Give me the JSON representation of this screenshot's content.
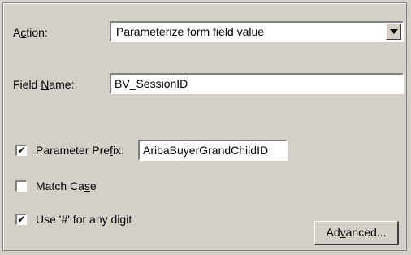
{
  "action": {
    "label_pre": "A",
    "label_u": "c",
    "label_post": "tion:",
    "selected": "Parameterize form field value",
    "dropdown_icon": "chevron-down-icon"
  },
  "field_name": {
    "label_pre": "Field ",
    "label_u": "N",
    "label_post": "ame:",
    "value": "BV_SessionID"
  },
  "parameter_prefix": {
    "checked": true,
    "check_glyph": "✔",
    "label_pre": "Parameter Pre",
    "label_u": "f",
    "label_post": "ix:",
    "value": "AribaBuyerGrandChildID"
  },
  "match_case": {
    "checked": false,
    "check_glyph": "",
    "label_pre": "Match Ca",
    "label_u": "s",
    "label_post": "e"
  },
  "use_hash": {
    "checked": true,
    "check_glyph": "✔",
    "label_pre": "Use '#' for any di",
    "label_u": "g",
    "label_post": "it"
  },
  "advanced_button": {
    "label_pre": "Ad",
    "label_u": "v",
    "label_post": "anced..."
  }
}
